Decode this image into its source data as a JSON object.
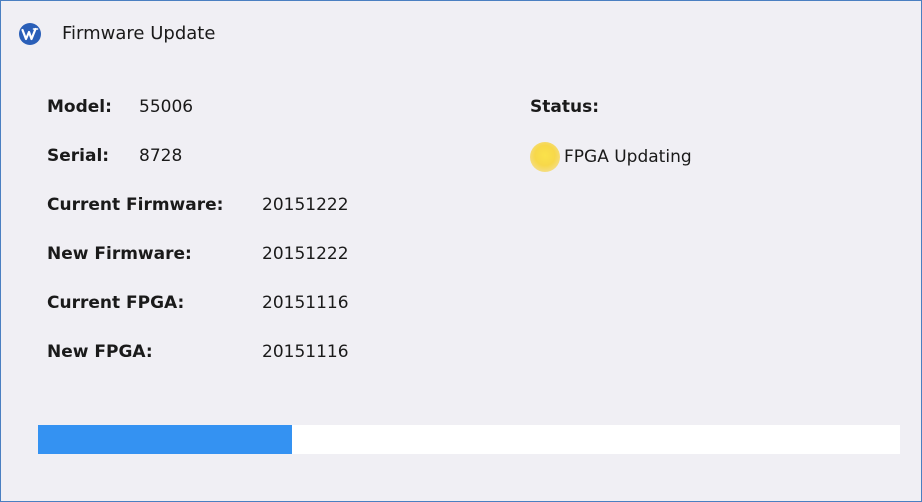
{
  "window": {
    "title": "Firmware Update",
    "icon": "wavecrest-logo-icon"
  },
  "device": {
    "model_label": "Model:",
    "model_value": "55006",
    "serial_label": "Serial:",
    "serial_value": "8728",
    "current_firmware_label": "Current Firmware:",
    "current_firmware_value": "20151222",
    "new_firmware_label": "New Firmware:",
    "new_firmware_value": "20151222",
    "current_fpga_label": "Current FPGA:",
    "current_fpga_value": "20151116",
    "new_fpga_label": "New FPGA:",
    "new_fpga_value": "20151116"
  },
  "status": {
    "label": "Status:",
    "text": "FPGA Updating",
    "indicator_color": "#f7d84a"
  },
  "progress": {
    "fraction": 0.295,
    "fill_color": "#3492f2"
  }
}
